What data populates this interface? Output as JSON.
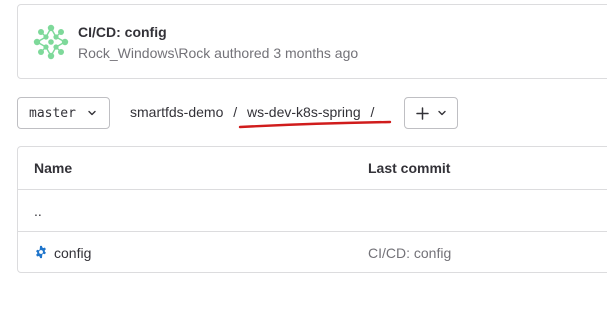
{
  "commit": {
    "title": "CI/CD: config",
    "author": "Rock_Windows\\Rock",
    "action": "authored",
    "time": "3 months ago",
    "avatar_icon": "identicon-avatar",
    "avatar_color": "#7ed99a"
  },
  "toolbar": {
    "branch": "master",
    "breadcrumb": {
      "project": "smartfds-demo",
      "separator": "/",
      "folder": "ws-dev-k8s-spring",
      "annotation_color": "#d01c1c"
    },
    "add_icon": "plus-icon",
    "dropdown_icon": "chevron-down-icon"
  },
  "table": {
    "headers": {
      "name": "Name",
      "last_commit": "Last commit"
    },
    "rows": [
      {
        "name": "..",
        "commit": ""
      },
      {
        "name": "config",
        "commit": "CI/CD: config",
        "icon": "gear-icon",
        "icon_color": "#1f75cb"
      }
    ]
  }
}
